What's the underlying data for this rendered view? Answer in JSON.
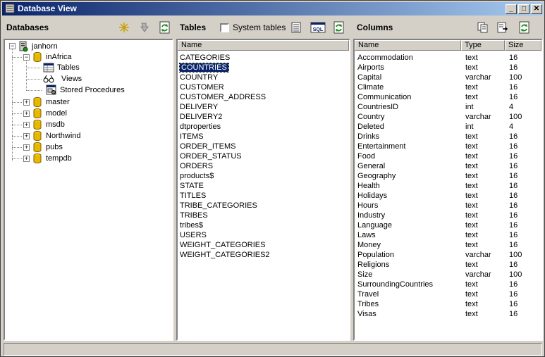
{
  "window": {
    "title": "Database View",
    "min": "_",
    "max": "□",
    "close": "✕"
  },
  "databases": {
    "title": "Databases",
    "server": "janhorn",
    "selected_db": "inAfrica",
    "children": [
      "Tables",
      "Views",
      "Stored Procedures"
    ],
    "other_dbs": [
      "master",
      "model",
      "msdb",
      "Northwind",
      "pubs",
      "tempdb"
    ],
    "expander_plus": "+",
    "expander_minus": "−"
  },
  "tables": {
    "title": "Tables",
    "system_tables_label": "System tables",
    "system_tables_checked": false,
    "column_name": "Name",
    "selected": "COUNTRIES",
    "items": [
      "CATEGORIES",
      "COUNTRIES",
      "COUNTRY",
      "CUSTOMER",
      "CUSTOMER_ADDRESS",
      "DELIVERY",
      "DELIVERY2",
      "dtproperties",
      "ITEMS",
      "ORDER_ITEMS",
      "ORDER_STATUS",
      "ORDERS",
      "products$",
      "STATE",
      "TITLES",
      "TRIBE_CATEGORIES",
      "TRIBES",
      "tribes$",
      "USERS",
      "WEIGHT_CATEGORIES",
      "WEIGHT_CATEGORIES2"
    ]
  },
  "columns": {
    "title": "Columns",
    "headers": [
      "Name",
      "Type",
      "Size"
    ],
    "rows": [
      [
        "Accommodation",
        "text",
        "16"
      ],
      [
        "Airports",
        "text",
        "16"
      ],
      [
        "Capital",
        "varchar",
        "100"
      ],
      [
        "Climate",
        "text",
        "16"
      ],
      [
        "Communication",
        "text",
        "16"
      ],
      [
        "CountriesID",
        "int",
        "4"
      ],
      [
        "Country",
        "varchar",
        "100"
      ],
      [
        "Deleted",
        "int",
        "4"
      ],
      [
        "Drinks",
        "text",
        "16"
      ],
      [
        "Entertainment",
        "text",
        "16"
      ],
      [
        "Food",
        "text",
        "16"
      ],
      [
        "General",
        "text",
        "16"
      ],
      [
        "Geography",
        "text",
        "16"
      ],
      [
        "Health",
        "text",
        "16"
      ],
      [
        "Holidays",
        "text",
        "16"
      ],
      [
        "Hours",
        "text",
        "16"
      ],
      [
        "Industry",
        "text",
        "16"
      ],
      [
        "Language",
        "text",
        "16"
      ],
      [
        "Laws",
        "text",
        "16"
      ],
      [
        "Money",
        "text",
        "16"
      ],
      [
        "Population",
        "varchar",
        "100"
      ],
      [
        "Religions",
        "text",
        "16"
      ],
      [
        "Size",
        "varchar",
        "100"
      ],
      [
        "SurroundingCountries",
        "text",
        "16"
      ],
      [
        "Travel",
        "text",
        "16"
      ],
      [
        "Tribes",
        "text",
        "16"
      ],
      [
        "Visas",
        "text",
        "16"
      ]
    ]
  },
  "colors": {
    "title_start": "#0a246a",
    "title_end": "#a6caf0",
    "selection": "#0a246a",
    "refresh_green": "#1a8a1a"
  }
}
